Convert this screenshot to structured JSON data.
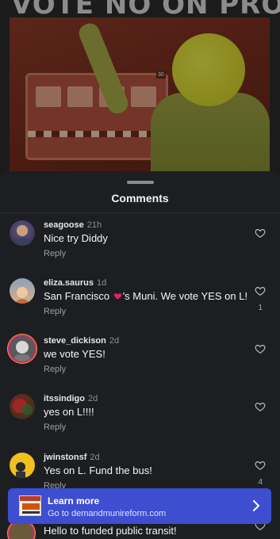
{
  "post": {
    "headline": "VOTE NO ON PROP E",
    "route_sign": "30"
  },
  "sheet": {
    "title": "Comments"
  },
  "comments": [
    {
      "user": "seagoose",
      "time": "21h",
      "text": "Nice try Diddy",
      "reply": "Reply",
      "likes": ""
    },
    {
      "user": "eliza.saurus",
      "time": "1d",
      "text_before": "San Francisco ",
      "text_after": "'s Muni. We vote YES on L!",
      "reply": "Reply",
      "likes": "1"
    },
    {
      "user": "steve_dickison",
      "time": "2d",
      "text": "we vote YES!",
      "reply": "Reply",
      "likes": ""
    },
    {
      "user": "itssindigo",
      "time": "2d",
      "text": "yes on L!!!!",
      "reply": "Reply",
      "likes": ""
    },
    {
      "user": "jwinstonsf",
      "time": "2d",
      "text": "Yes on L. Fund the bus!",
      "reply": "Reply",
      "likes": "4"
    },
    {
      "text": "Hello to funded public transit!"
    }
  ],
  "banner": {
    "title": "Learn more",
    "subtitle": "Go to demandmunireform.com"
  },
  "colors": {
    "sheet_bg": "#1c1e22",
    "banner_bg": "#3e4ed1",
    "heart_red": "#e0245e"
  },
  "icons": [
    "heart-outline-icon",
    "heart-emoji-icon",
    "chevron-right-icon"
  ]
}
